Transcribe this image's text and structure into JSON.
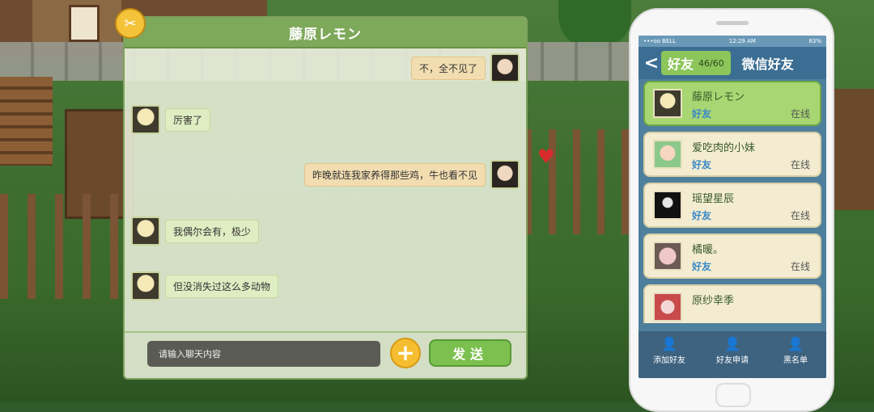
{
  "chat": {
    "title": "藤原レモン",
    "close_icon": "✂",
    "messages": [
      {
        "side": "right",
        "avatar": "me",
        "text": "不，全不见了"
      },
      {
        "side": "left",
        "avatar": "fuji",
        "text": "厉害了"
      },
      {
        "side": "right",
        "avatar": "me",
        "text": "昨晚就连我家养得那些鸡，牛也看不见"
      },
      {
        "side": "left",
        "avatar": "fuji",
        "text": "我偶尔会有，极少"
      },
      {
        "side": "left",
        "avatar": "fuji",
        "text": "但没消失过这么多动物"
      }
    ],
    "input_placeholder": "请输入聊天内容",
    "plus_label": "+",
    "send_label": "发送"
  },
  "phone": {
    "status": {
      "carrier": "•••oo BELL",
      "time": "12:29 AM",
      "battery": "83%"
    },
    "tab_friends": "好友",
    "friend_count": "46/60",
    "tab_wechat": "微信好友",
    "friends": [
      {
        "name": "藤原レモン",
        "tag": "好友",
        "status": "在线",
        "selected": true
      },
      {
        "name": "爱吃肉的小妹",
        "tag": "好友",
        "status": "在线",
        "selected": false
      },
      {
        "name": "瑶望星辰",
        "tag": "好友",
        "status": "在线",
        "selected": false
      },
      {
        "name": "橘暖。",
        "tag": "好友",
        "status": "在线",
        "selected": false
      },
      {
        "name": "原纱幸季",
        "tag": "",
        "status": "",
        "selected": false
      }
    ],
    "footer": {
      "add_friend": "添加好友",
      "friend_requests": "好友申请",
      "blacklist": "黑名单"
    }
  },
  "colors": {
    "accent_green": "#7cc04f",
    "header_green": "#7ea85a",
    "phone_blue": "#3c6e93"
  }
}
